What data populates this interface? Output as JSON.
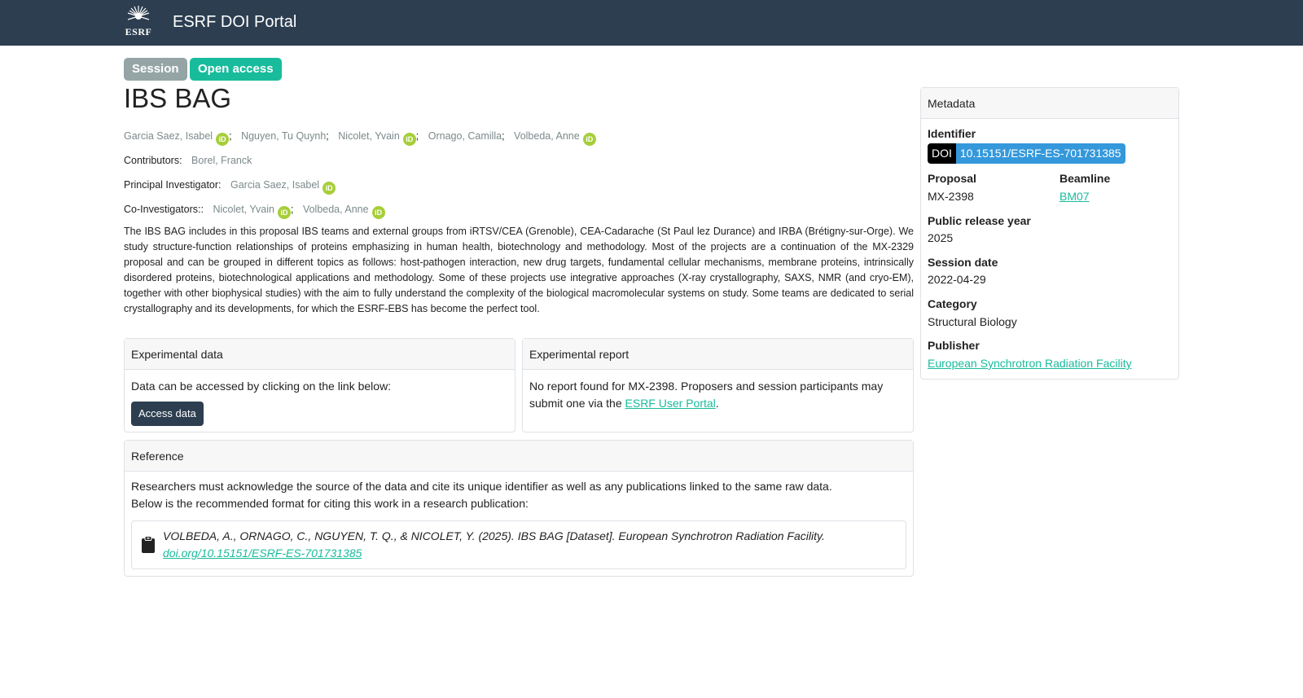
{
  "navbar": {
    "brand": "ESRF DOI Portal",
    "logo_text": "ESRF"
  },
  "badges": {
    "session": "Session",
    "open_access": "Open access"
  },
  "title": "IBS BAG",
  "authors": [
    "Garcia Saez, Isabel",
    "Nguyen, Tu Quynh",
    "Nicolet, Yvain",
    "Ornago, Camilla",
    "Volbeda, Anne"
  ],
  "contributors": {
    "label": "Contributors:",
    "names": [
      "Borel, Franck"
    ]
  },
  "principal_investigator": {
    "label": "Principal Investigator:",
    "names": [
      "Garcia Saez, Isabel"
    ]
  },
  "co_investigators": {
    "label": "Co-Investigators::",
    "names": [
      "Nicolet, Yvain",
      "Volbeda, Anne"
    ]
  },
  "orcid_icon": "iD",
  "abstract": "The IBS BAG includes in this proposal IBS teams and external groups from iRTSV/CEA (Grenoble), CEA-Cadarache (St Paul lez Durance) and IRBA (Brétigny-sur-Orge). We study structure-function relationships of proteins emphasizing in human health, biotechnology and methodology. Most of the projects are a continuation of the MX-2329 proposal and can be grouped in different topics as follows: host-pathogen interaction, new drug targets, fundamental cellular mechanisms, membrane proteins, intrinsically disordered proteins, biotechnological applications and methodology. Some of these projects use integrative approaches (X-ray crystallography, SAXS, NMR (and cryo-EM), together with other biophysical studies) with the aim to fully understand the complexity of the biological macromolecular systems on study. Some teams are dedicated to serial crystallography and its developments, for which the ESRF-EBS has become the perfect tool.",
  "experimental_data": {
    "header": "Experimental data",
    "text": "Data can be accessed by clicking on the link below:",
    "button": "Access data"
  },
  "experimental_report": {
    "header": "Experimental report",
    "text_before": "No report found for MX-2398. Proposers and session participants may submit one via the ",
    "link": "ESRF User Portal",
    "text_after": "."
  },
  "reference": {
    "header": "Reference",
    "line1": "Researchers must acknowledge the source of the data and cite its unique identifier as well as any publications linked to the same raw data.",
    "line2": "Below is the recommended format for citing this work in a research publication:",
    "citation": "VOLBEDA, A., ORNAGO, C., NGUYEN, T. Q., & NICOLET, Y. (2025). IBS BAG [Dataset]. European Synchrotron Radiation Facility. ",
    "citation_link": "doi.org/10.15151/ESRF-ES-701731385"
  },
  "metadata": {
    "header": "Metadata",
    "identifier_label": "Identifier",
    "doi_tag": "DOI",
    "doi_value": "10.15151/ESRF-ES-701731385",
    "proposal_label": "Proposal",
    "proposal_value": "MX-2398",
    "beamline_label": "Beamline",
    "beamline_value": "BM07",
    "release_label": "Public release year",
    "release_value": "2025",
    "session_date_label": "Session date",
    "session_date_value": "2022-04-29",
    "category_label": "Category",
    "category_value": "Structural Biology",
    "publisher_label": "Publisher",
    "publisher_value": "European Synchrotron Radiation Facility"
  }
}
